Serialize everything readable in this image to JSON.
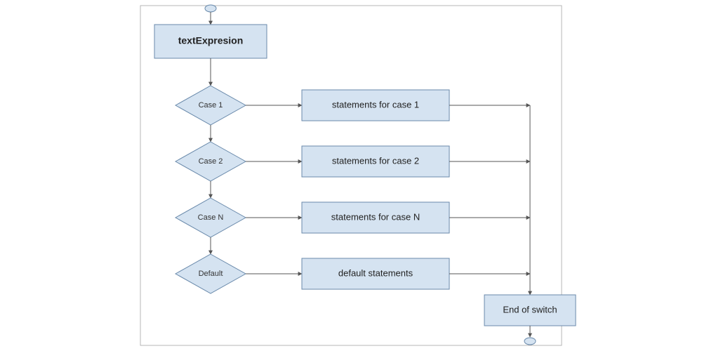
{
  "entry": {
    "label": "textExpresion"
  },
  "cases": [
    {
      "decision": "Case 1",
      "statement": "statements for case 1"
    },
    {
      "decision": "Case 2",
      "statement": "statements for case 2"
    },
    {
      "decision": "Case N",
      "statement": "statements for case N"
    },
    {
      "decision": "Default",
      "statement": "default statements"
    }
  ],
  "end": {
    "label": "End of switch"
  }
}
